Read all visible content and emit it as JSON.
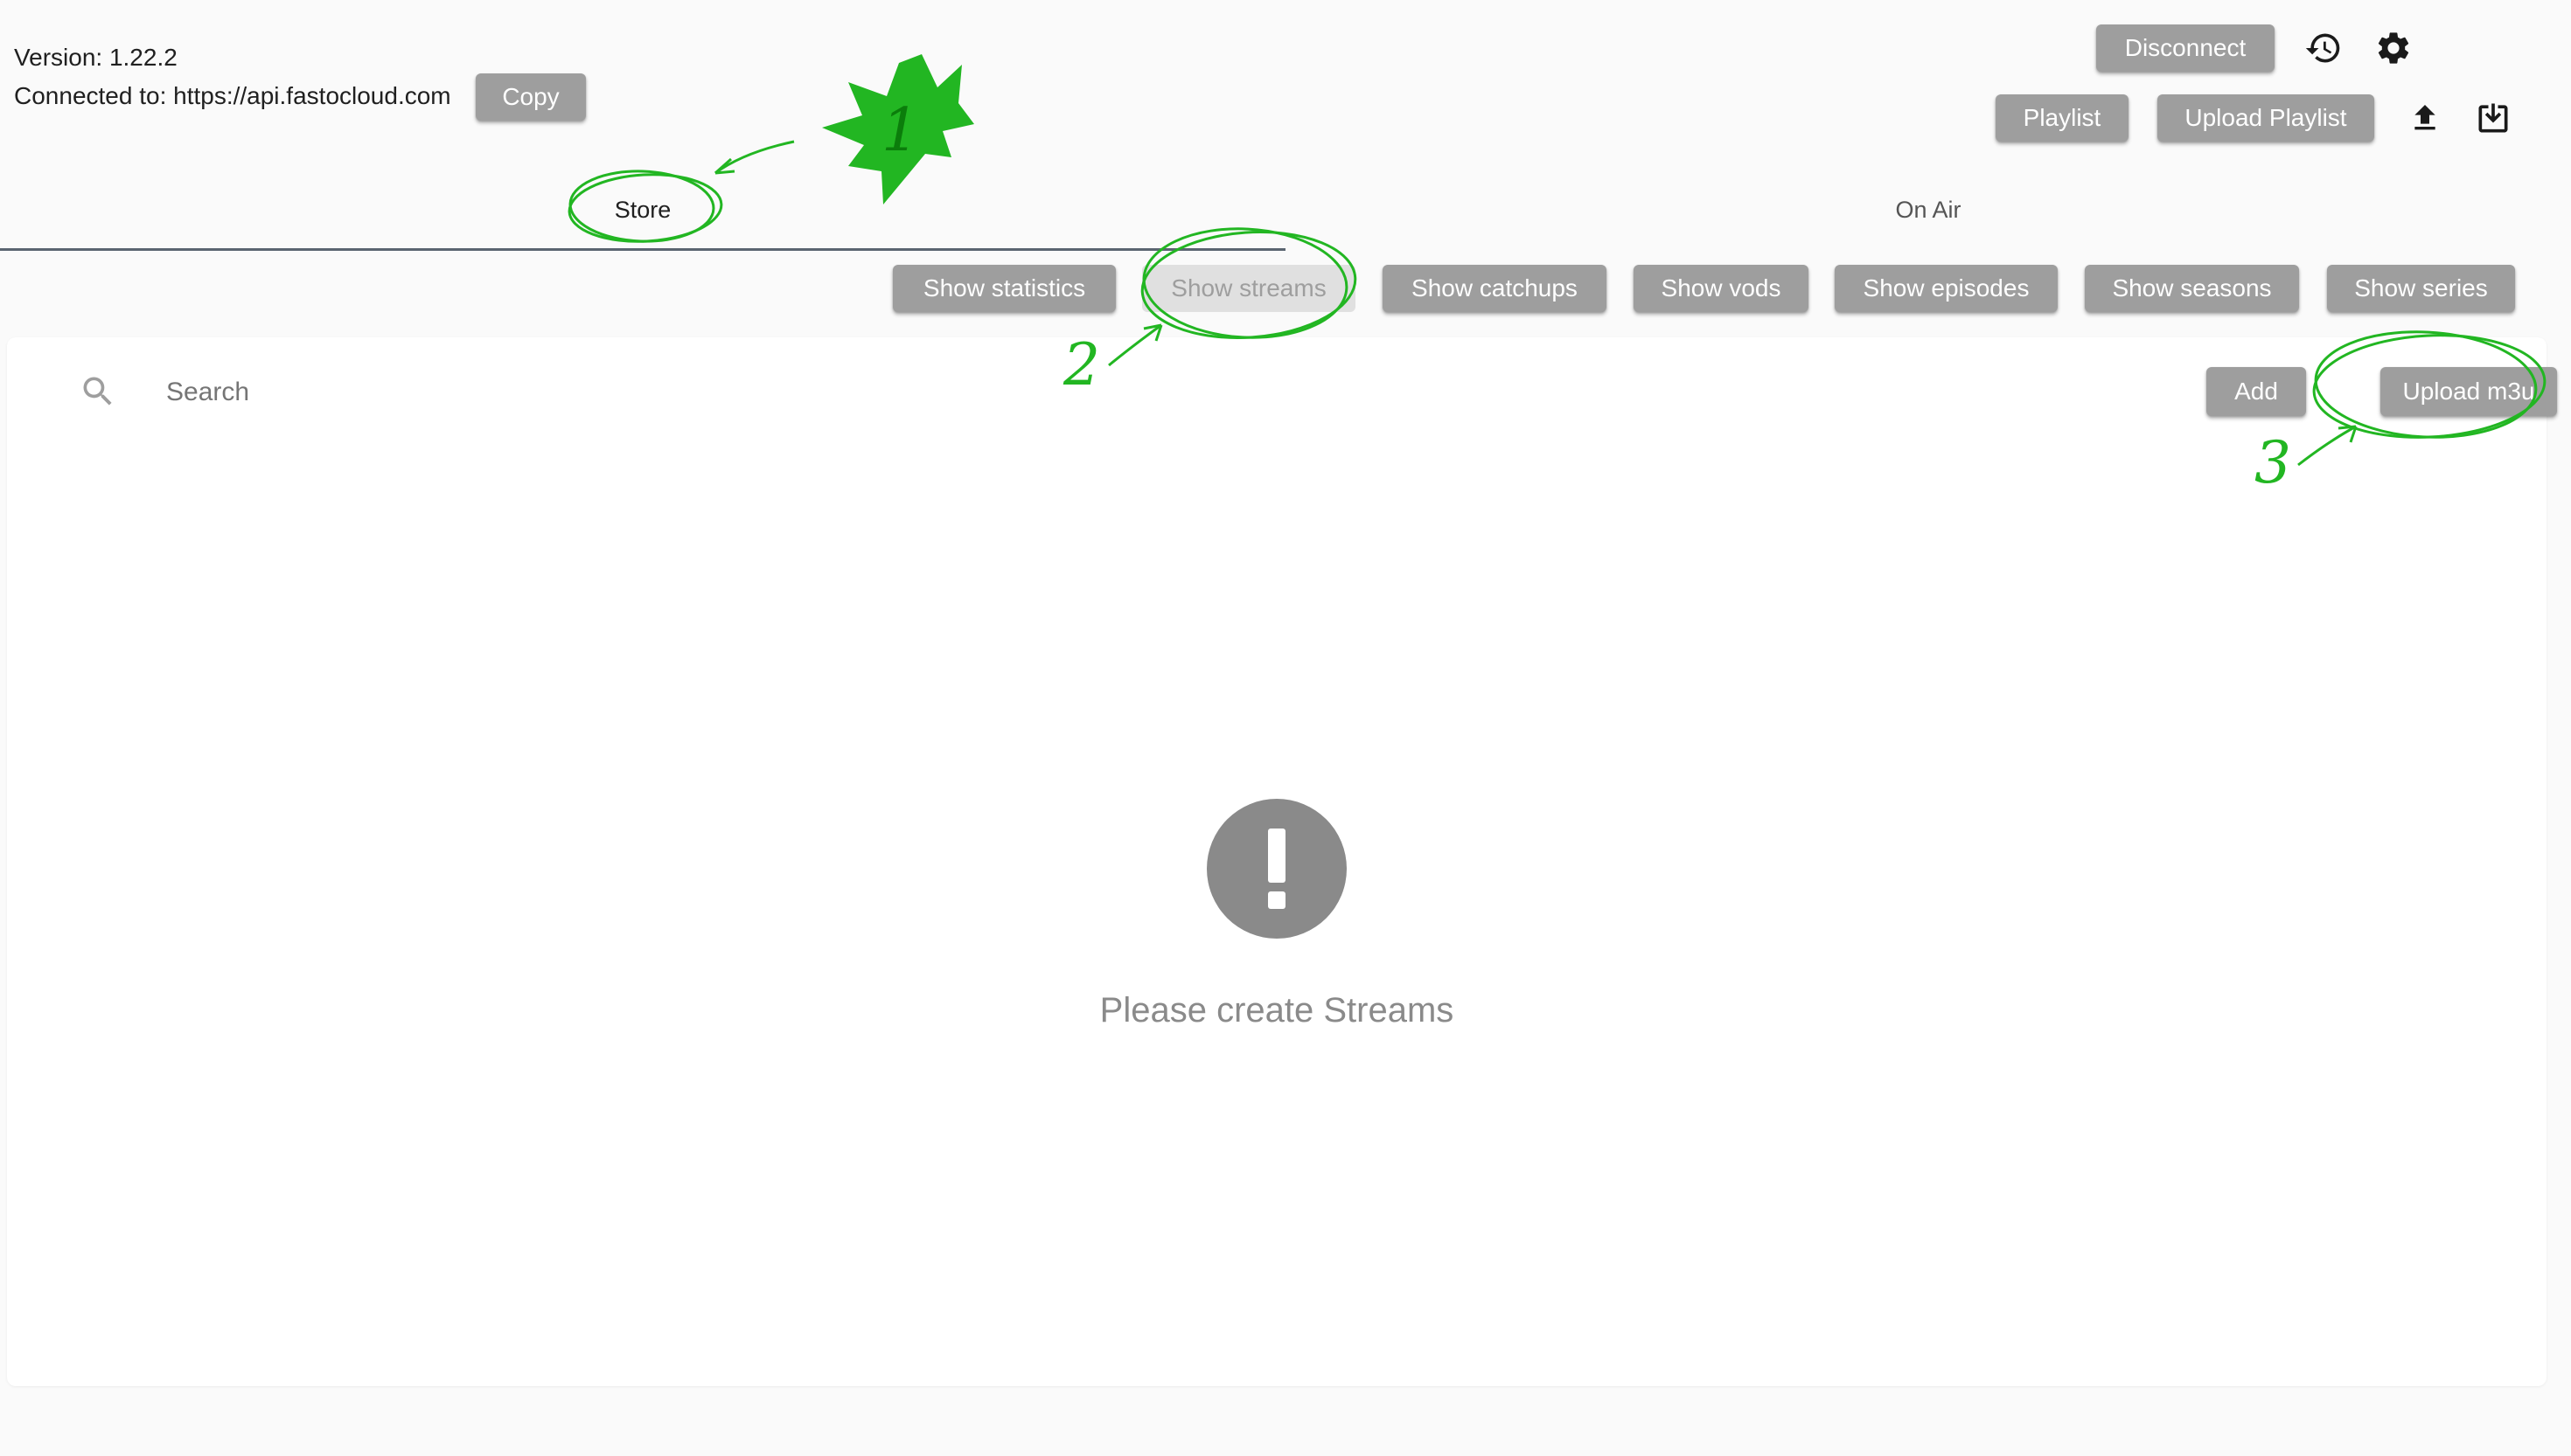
{
  "header": {
    "version": "Version: 1.22.2",
    "connected": "Connected to: https://api.fastocloud.com",
    "copy_label": "Copy"
  },
  "top_actions": {
    "disconnect_label": "Disconnect",
    "playlist_label": "Playlist",
    "upload_playlist_label": "Upload Playlist",
    "icons": [
      "history-icon",
      "settings-gear-icon",
      "upload-icon",
      "download-icon"
    ]
  },
  "tabs": [
    {
      "label": "Store",
      "selected": true
    },
    {
      "label": "On Air",
      "selected": false
    }
  ],
  "filters": [
    {
      "label": "Show statistics",
      "enabled": true
    },
    {
      "label": "Show streams",
      "enabled": false
    },
    {
      "label": "Show catchups",
      "enabled": true
    },
    {
      "label": "Show vods",
      "enabled": true
    },
    {
      "label": "Show episodes",
      "enabled": true
    },
    {
      "label": "Show seasons",
      "enabled": true
    },
    {
      "label": "Show series",
      "enabled": true
    }
  ],
  "search": {
    "placeholder": "Search"
  },
  "panel_actions": {
    "add_label": "Add",
    "upload_m3u_label": "Upload m3u"
  },
  "empty_state": {
    "message": "Please create Streams"
  },
  "annotations": {
    "step1": "1",
    "step2": "2",
    "step3": "3",
    "color": "#22b622"
  }
}
